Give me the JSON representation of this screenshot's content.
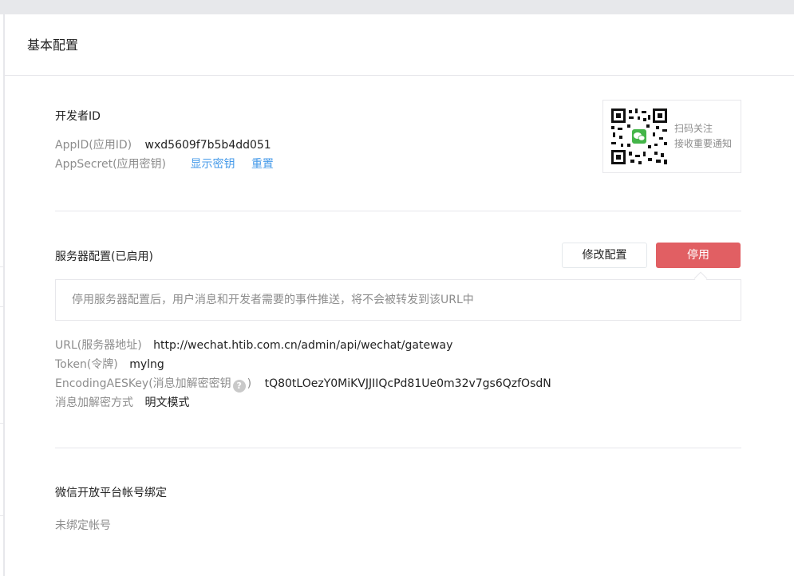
{
  "page": {
    "title": "基本配置"
  },
  "developer": {
    "title": "开发者ID",
    "appid_label": "AppID(应用ID)",
    "appid_value": "wxd5609f7b5b4dd051",
    "secret_label": "AppSecret(应用密钥)",
    "show_secret_link": "显示密钥",
    "reset_link": "重置"
  },
  "qrcode": {
    "line1": "扫码关注",
    "line2": "接收重要通知"
  },
  "server": {
    "title": "服务器配置(已启用)",
    "modify_button": "修改配置",
    "disable_button": "停用",
    "tip": "停用服务器配置后，用户消息和开发者需要的事件推送，将不会被转发到该URL中",
    "url_label": "URL(服务器地址)",
    "url_value": "http://wechat.htib.com.cn/admin/api/wechat/gateway",
    "token_label": "Token(令牌)",
    "token_value": "mylng",
    "aeskey_label": "EncodingAESKey(消息加解密密钥",
    "aeskey_label_end": ")",
    "aeskey_value": "tQ80tLOezY0MiKVJJIIQcPd81Ue0m32v7gs6QzfOsdN",
    "mode_label": "消息加解密方式",
    "mode_value": "明文模式",
    "help_icon": "?"
  },
  "binding": {
    "title": "微信开放平台帐号绑定",
    "status": "未绑定帐号"
  },
  "colors": {
    "danger": "#e15f63",
    "link": "#459ae9",
    "wechat_green": "#44b549"
  }
}
